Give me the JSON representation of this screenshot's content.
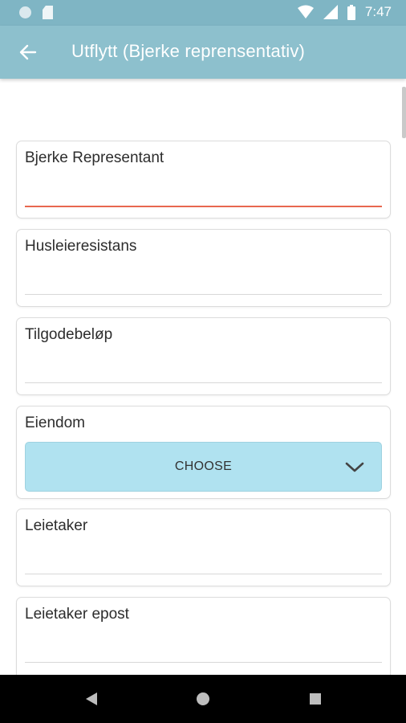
{
  "status_bar": {
    "time": "7:47",
    "icons": [
      "notification-dot-icon",
      "sd-card-icon",
      "wifi-icon",
      "signal-icon",
      "battery-icon"
    ]
  },
  "app_bar": {
    "title": "Utflytt (Bjerke reprensentativ)",
    "back_icon": "arrow-left-icon"
  },
  "form": {
    "fields": [
      {
        "label": "Bjerke Representant",
        "value": ""
      },
      {
        "label": "Husleieresistans",
        "value": ""
      },
      {
        "label": "Tilgodebeløp",
        "value": ""
      },
      {
        "label": "Eiendom",
        "select_label": "CHOOSE"
      },
      {
        "label": "Leietaker",
        "value": ""
      },
      {
        "label": "Leietaker epost",
        "value": ""
      }
    ]
  },
  "colors": {
    "app_bar": "#8dc0cd",
    "status_bar": "#7fb5c4",
    "active_underline": "#e8674f",
    "select_background": "#b0e2f0"
  },
  "nav_bar": {
    "icons": [
      "back-triangle-icon",
      "home-circle-icon",
      "recents-square-icon"
    ]
  }
}
